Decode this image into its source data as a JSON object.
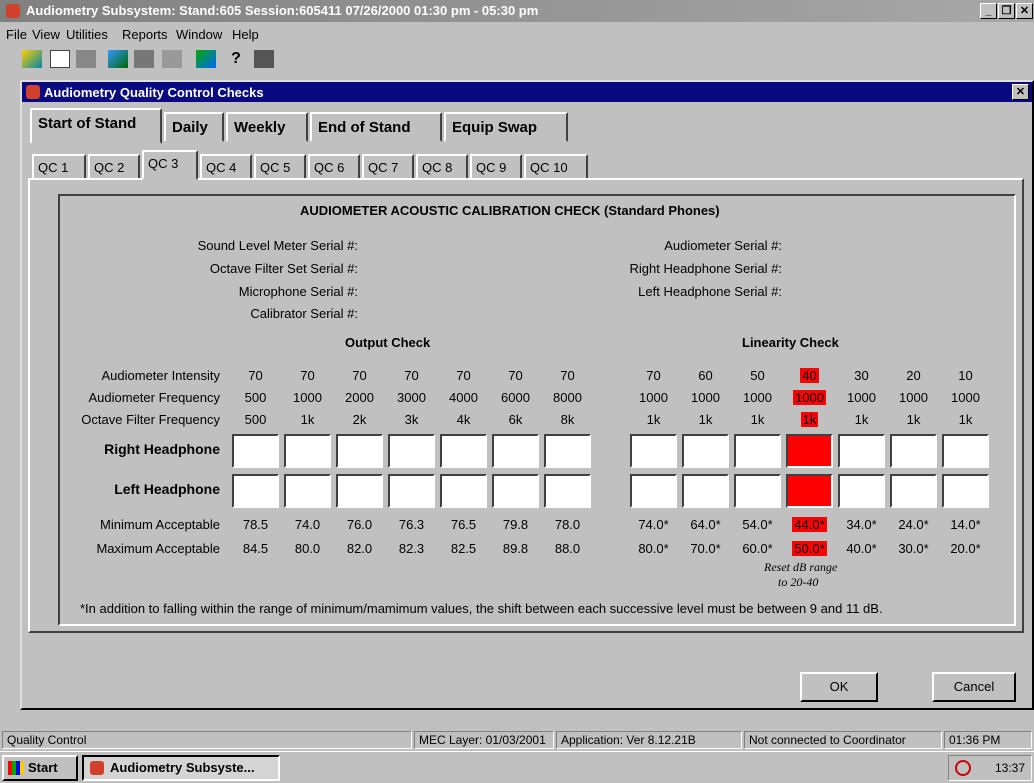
{
  "app": {
    "title": "Audiometry Subsystem: Stand:605 Session:605411 07/26/2000 01:30 pm - 05:30 pm"
  },
  "menu": [
    "File",
    "View",
    "Utilities",
    "Reports",
    "Window",
    "Help"
  ],
  "dialog": {
    "title": "Audiometry Quality Control Checks",
    "main_tabs": [
      "Start of Stand",
      "Daily",
      "Weekly",
      "End of Stand",
      "Equip Swap"
    ],
    "active_main_tab": "Start of Stand",
    "sub_tabs": [
      "QC 1",
      "QC 2",
      "QC 3",
      "QC 4",
      "QC 5",
      "QC 6",
      "QC 7",
      "QC 8",
      "QC 9",
      "QC 10"
    ],
    "active_sub_tab": "QC 3",
    "ok_label": "OK",
    "cancel_label": "Cancel"
  },
  "form": {
    "heading": "AUDIOMETER ACOUSTIC CALIBRATION CHECK (Standard Phones)",
    "serials_left": [
      "Sound Level Meter Serial #:",
      "Octave Filter Set Serial #:",
      "Microphone Serial #:",
      "Calibrator Serial #:"
    ],
    "serials_right": [
      "Audiometer Serial #:",
      "Right Headphone Serial #:",
      "Left Headphone Serial #:"
    ],
    "output_title": "Output Check",
    "linearity_title": "Linearity Check",
    "row_labels": {
      "intensity": "Audiometer Intensity",
      "frequency": "Audiometer Frequency",
      "octave": "Octave Filter Frequency",
      "right": "Right Headphone",
      "left": "Left Headphone",
      "min": "Minimum Acceptable",
      "max": "Maximum Acceptable"
    },
    "output": {
      "intensity": [
        "70",
        "70",
        "70",
        "70",
        "70",
        "70",
        "70"
      ],
      "frequency": [
        "500",
        "1000",
        "2000",
        "3000",
        "4000",
        "6000",
        "8000"
      ],
      "octave": [
        "500",
        "1k",
        "2k",
        "3k",
        "4k",
        "6k",
        "8k"
      ],
      "min": [
        "78.5",
        "74.0",
        "76.0",
        "76.3",
        "76.5",
        "79.8",
        "78.0"
      ],
      "max": [
        "84.5",
        "80.0",
        "82.0",
        "82.3",
        "82.5",
        "89.8",
        "88.0"
      ]
    },
    "linearity": {
      "intensity": [
        "70",
        "60",
        "50",
        "40",
        "30",
        "20",
        "10"
      ],
      "frequency": [
        "1000",
        "1000",
        "1000",
        "1000",
        "1000",
        "1000",
        "1000"
      ],
      "octave": [
        "1k",
        "1k",
        "1k",
        "1k",
        "1k",
        "1k",
        "1k"
      ],
      "min": [
        "74.0*",
        "64.0*",
        "54.0*",
        "44.0*",
        "34.0*",
        "24.0*",
        "14.0*"
      ],
      "max": [
        "80.0*",
        "70.0*",
        "60.0*",
        "50.0*",
        "40.0*",
        "30.0*",
        "20.0*"
      ],
      "highlight_column": 3,
      "highlight_color": "#ff0000"
    },
    "reset_note_line1": "Reset dB range",
    "reset_note_line2": "to 20-40",
    "footnote": "*In addition to falling within the range of minimum/mamimum values, the shift between each successive level must be between 9 and 11 dB."
  },
  "status": {
    "left": "Quality Control",
    "mec": "MEC Layer: 01/03/2001",
    "application": "Application: Ver 8.12.21B",
    "connection": "Not connected to Coordinator",
    "time": "01:36 PM"
  },
  "taskbar": {
    "start": "Start",
    "task": "Audiometry Subsyste...",
    "clock": "13:37"
  }
}
